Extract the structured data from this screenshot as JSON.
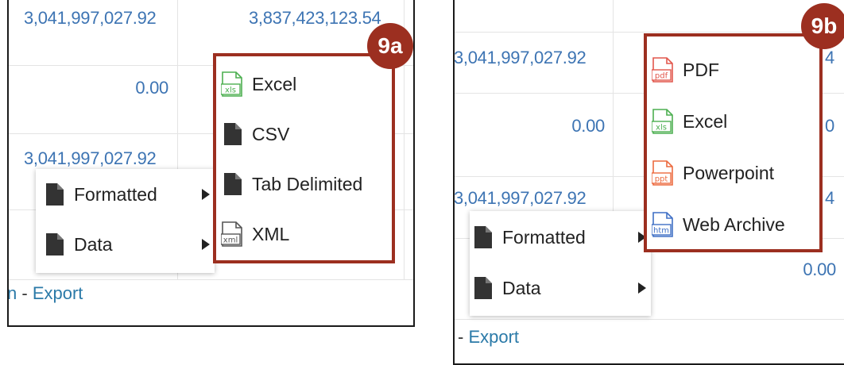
{
  "panel_a": {
    "badge": "9a",
    "cells": {
      "r1c1": "3,041,997,027.92",
      "r1c2": "3,837,423,123.54",
      "r2c1": "0.00",
      "r3c1": "3,041,997,027.92"
    },
    "footer": {
      "prefix": "n",
      "separator": " - ",
      "link": "Export"
    },
    "context_menu": [
      {
        "label": "Formatted",
        "icon": "document-icon",
        "has_submenu": true
      },
      {
        "label": "Data",
        "icon": "document-icon",
        "has_submenu": true
      }
    ],
    "submenu": [
      {
        "label": "Excel",
        "icon": "excel-file-icon",
        "icon_text": "xls",
        "color": "#4caf50"
      },
      {
        "label": "CSV",
        "icon": "document-icon"
      },
      {
        "label": "Tab Delimited",
        "icon": "document-icon"
      },
      {
        "label": "XML",
        "icon": "xml-file-icon",
        "icon_text": "xml",
        "color": "#555555"
      }
    ]
  },
  "panel_b": {
    "badge": "9b",
    "cells": {
      "r1c1": "3,041,997,027.92",
      "r2c1": "0.00",
      "r3c1": "3,041,997,027.92",
      "r4c2": "0.00",
      "r1c2_partial": "4",
      "r2c2_partial": "0",
      "r3c2_partial": "4"
    },
    "footer": {
      "separator": "- ",
      "link": "Export"
    },
    "context_menu": [
      {
        "label": "Formatted",
        "icon": "document-icon",
        "has_submenu": true
      },
      {
        "label": "Data",
        "icon": "document-icon",
        "has_submenu": true
      }
    ],
    "submenu": [
      {
        "label": "PDF",
        "icon": "pdf-file-icon",
        "icon_text": "pdf",
        "color": "#e2574c"
      },
      {
        "label": "Excel",
        "icon": "excel-file-icon",
        "icon_text": "xls",
        "color": "#4caf50"
      },
      {
        "label": "Powerpoint",
        "icon": "powerpoint-file-icon",
        "icon_text": "ppt",
        "color": "#ec6a3f"
      },
      {
        "label": "Web Archive",
        "icon": "web-archive-file-icon",
        "icon_text": "htm",
        "color": "#3f6fc5"
      }
    ]
  },
  "colors": {
    "highlight": "#9c2f20",
    "link": "#2b7aa8",
    "value": "#3d74b3"
  }
}
